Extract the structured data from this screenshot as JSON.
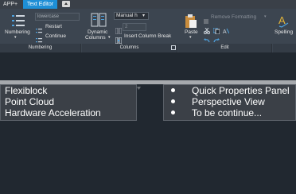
{
  "tabs": {
    "app": "APP+",
    "text_editor": "Text Editor"
  },
  "ribbon": {
    "numbering": {
      "button_label": "Numbering",
      "style_value": "lowercase",
      "restart_label": "Restart",
      "continue_label": "Continue",
      "group_label": "Numbering"
    },
    "columns": {
      "dynamic_label_1": "Dynamic",
      "dynamic_label_2": "Columns",
      "manual_value": "Manual h",
      "count_value": "2",
      "insert_break_label": "Insert Column Break",
      "group_label": "Columns"
    },
    "edit": {
      "paste_label": "Paste",
      "remove_formatting_label": "Remove Formatting",
      "group_label": "Edit"
    },
    "spelling_label": "Spelling"
  },
  "left_text": [
    "Flexiblock",
    "Point Cloud",
    "Hardware Acceleration"
  ],
  "right_text": [
    "Quick Properties Panel",
    "Perspective View",
    "To be continue..."
  ],
  "colors": {
    "accent": "#1e8fd6",
    "ribbon_bg": "#3c4550",
    "canvas_bg": "#212830"
  }
}
